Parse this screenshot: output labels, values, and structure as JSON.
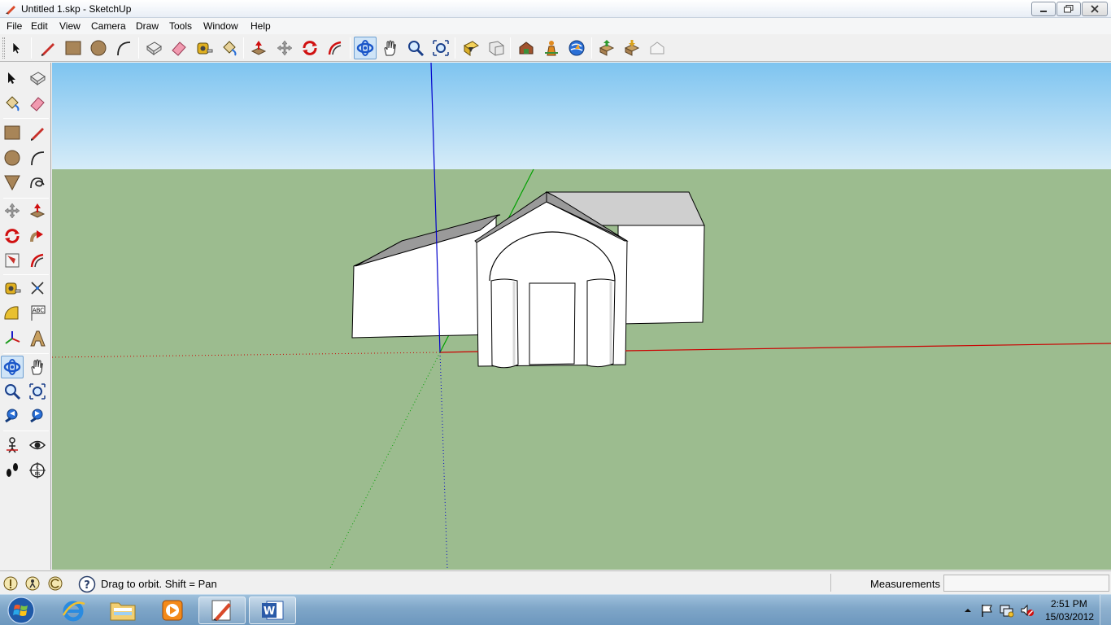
{
  "window": {
    "title": "Untitled 1.skp - SketchUp"
  },
  "menu": [
    "File",
    "Edit",
    "View",
    "Camera",
    "Draw",
    "Tools",
    "Window",
    "Help"
  ],
  "status": {
    "hint": "Drag to orbit.  Shift = Pan",
    "measurements_label": "Measurements",
    "measurements_value": ""
  },
  "taskbar": {
    "clock_time": "2:51 PM",
    "clock_date": "15/03/2012",
    "apps": [
      "internet-explorer",
      "windows-explorer",
      "media-player",
      "sketchup",
      "microsoft-word"
    ]
  },
  "colors": {
    "sky_top": "#7ec4f0",
    "sky_bottom": "#d6ecf8",
    "ground": "#9cbc8f",
    "red_axis": "#cc0000",
    "green_axis": "#00a000",
    "blue_axis": "#0000cc",
    "face_front": "#ffffff",
    "roof_face": "#9a9a9a"
  }
}
